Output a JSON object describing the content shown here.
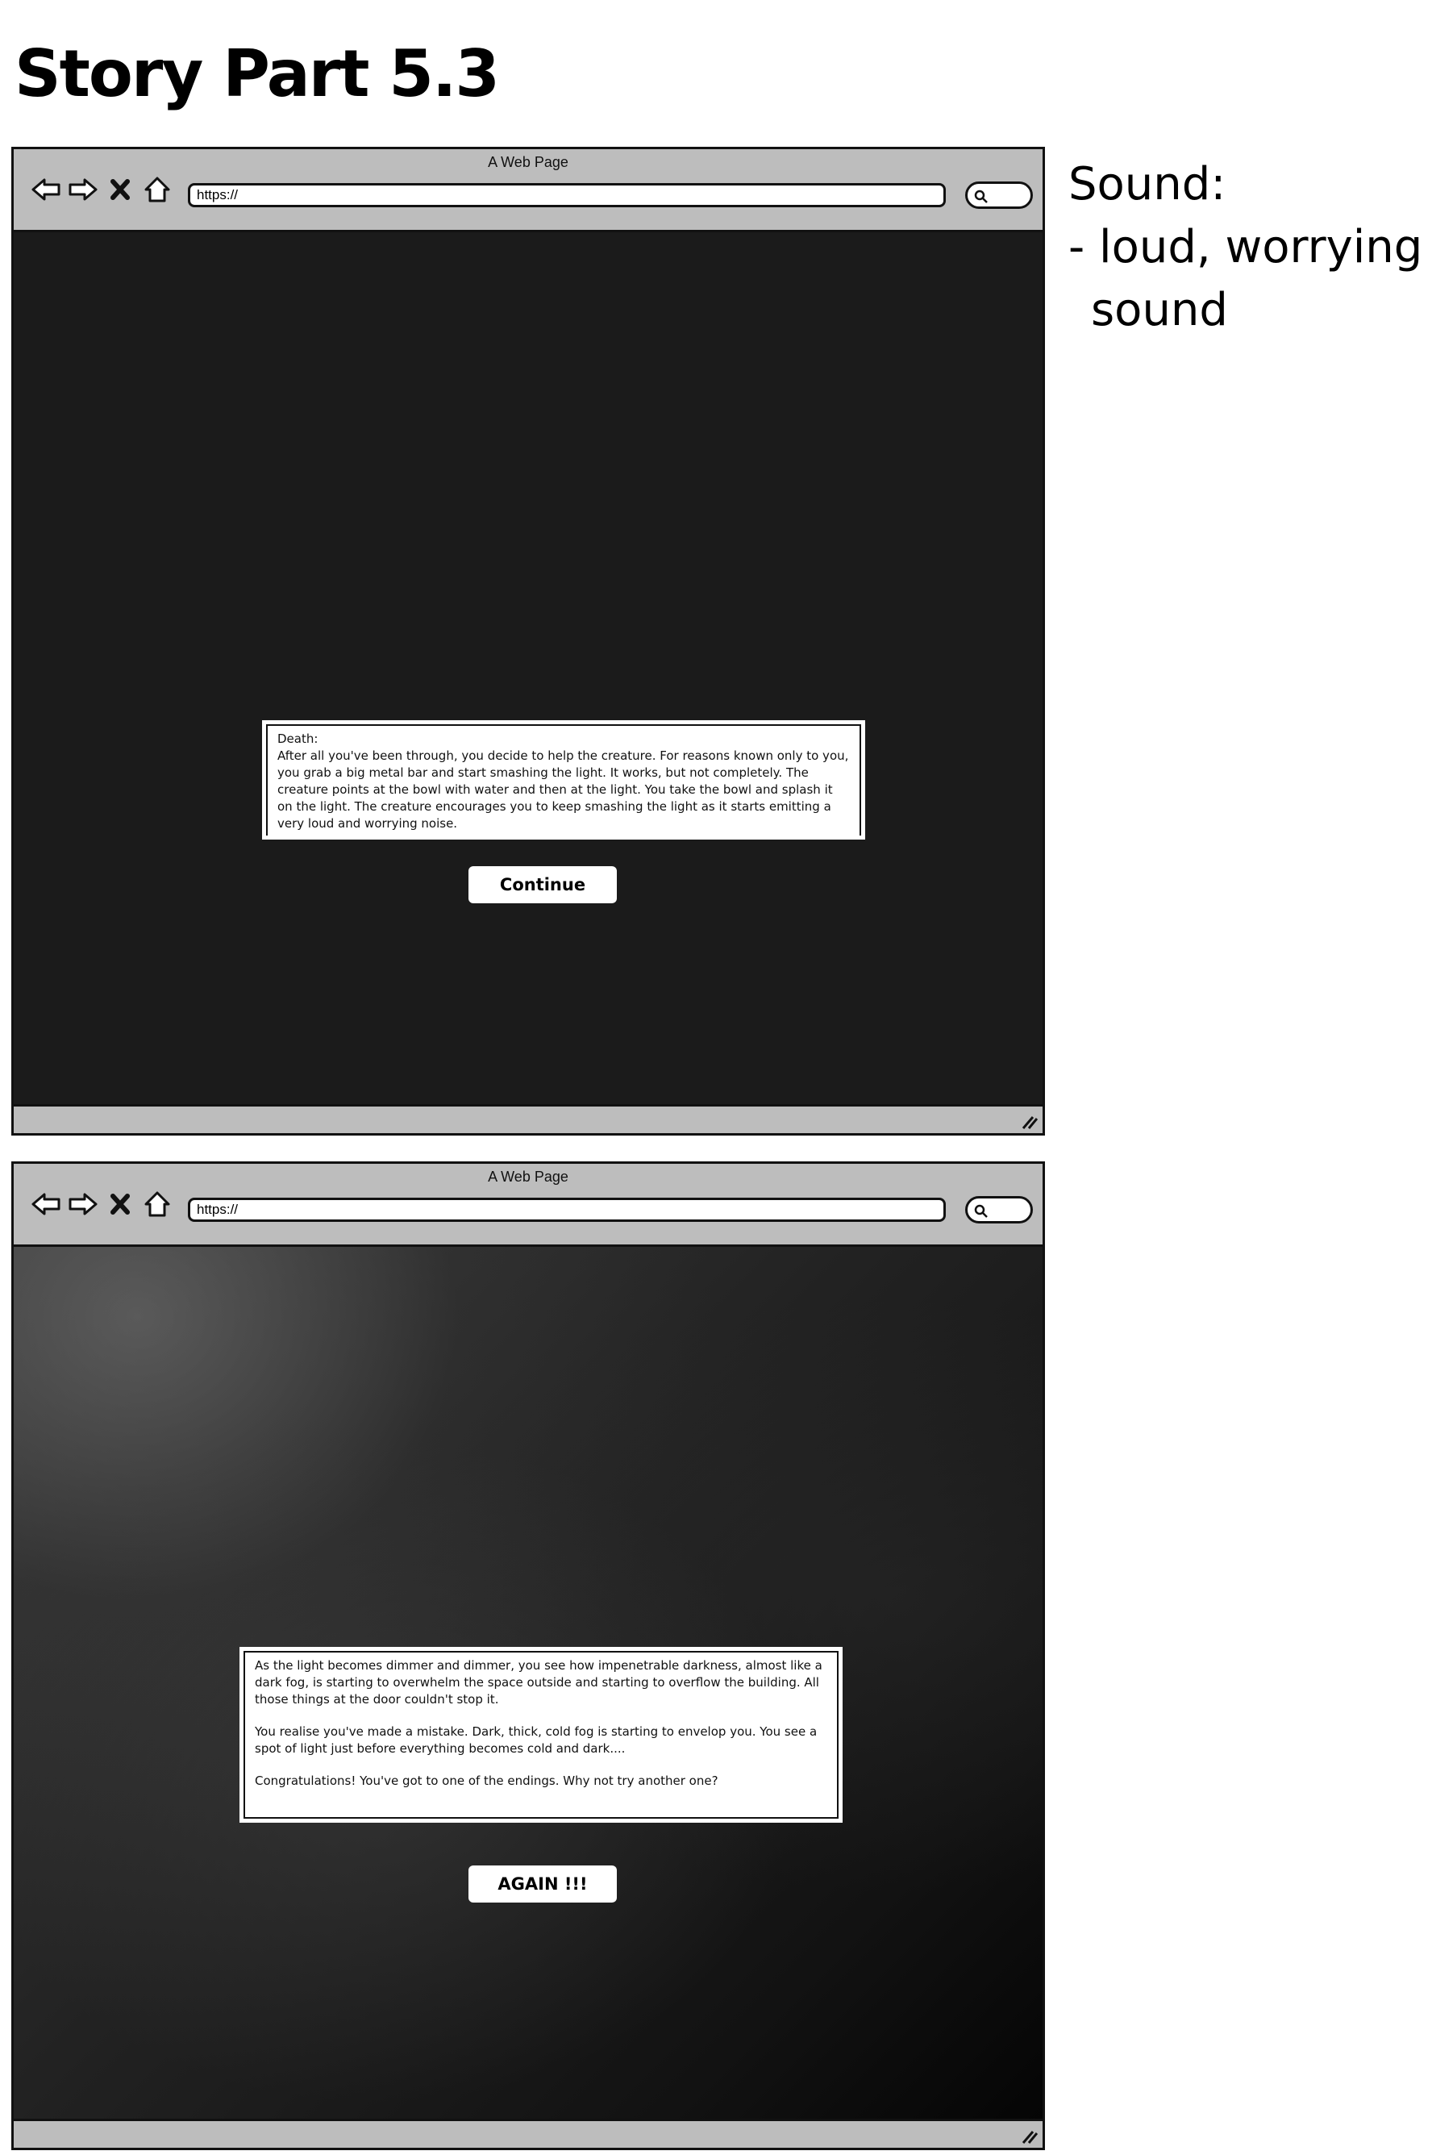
{
  "page": {
    "title": "Story Part 5.3"
  },
  "notes": {
    "heading": "Sound:",
    "items": [
      {
        "line1": "loud, worrying",
        "line2": "sound"
      }
    ]
  },
  "browser_1": {
    "window_title": "A Web Page",
    "url": "https://",
    "dialog": {
      "heading": "Death:",
      "body": "After all you've been through, you decide to help the creature. For reasons known only to you, you grab a big metal bar and start smashing the light. It works, but not completely. The creature points at the bowl with water and then at the light. You take the bowl and splash it on the light. The creature encourages you to keep smashing the light as it starts emitting a very loud and worrying noise."
    },
    "continue_label": "Continue"
  },
  "browser_2": {
    "window_title": "A Web Page",
    "url": "https://",
    "dialog": {
      "paragraphs": [
        "As the light becomes dimmer and dimmer, you see how impenetrable darkness, almost like a dark fog, is starting to overwhelm the space outside and starting to overflow the building. All those things at the door couldn't stop it.",
        "You realise you've made a mistake. Dark, thick, cold fog is starting to envelop you. You see a spot of light just before everything becomes cold and dark....",
        "Congratulations! You've got to one of the endings. Why not try another one?"
      ]
    },
    "again_label": "AGAIN !!!"
  },
  "icons": [
    "back-arrow-icon",
    "forward-arrow-icon",
    "close-icon",
    "home-icon",
    "search-icon",
    "resize-grip-icon"
  ]
}
